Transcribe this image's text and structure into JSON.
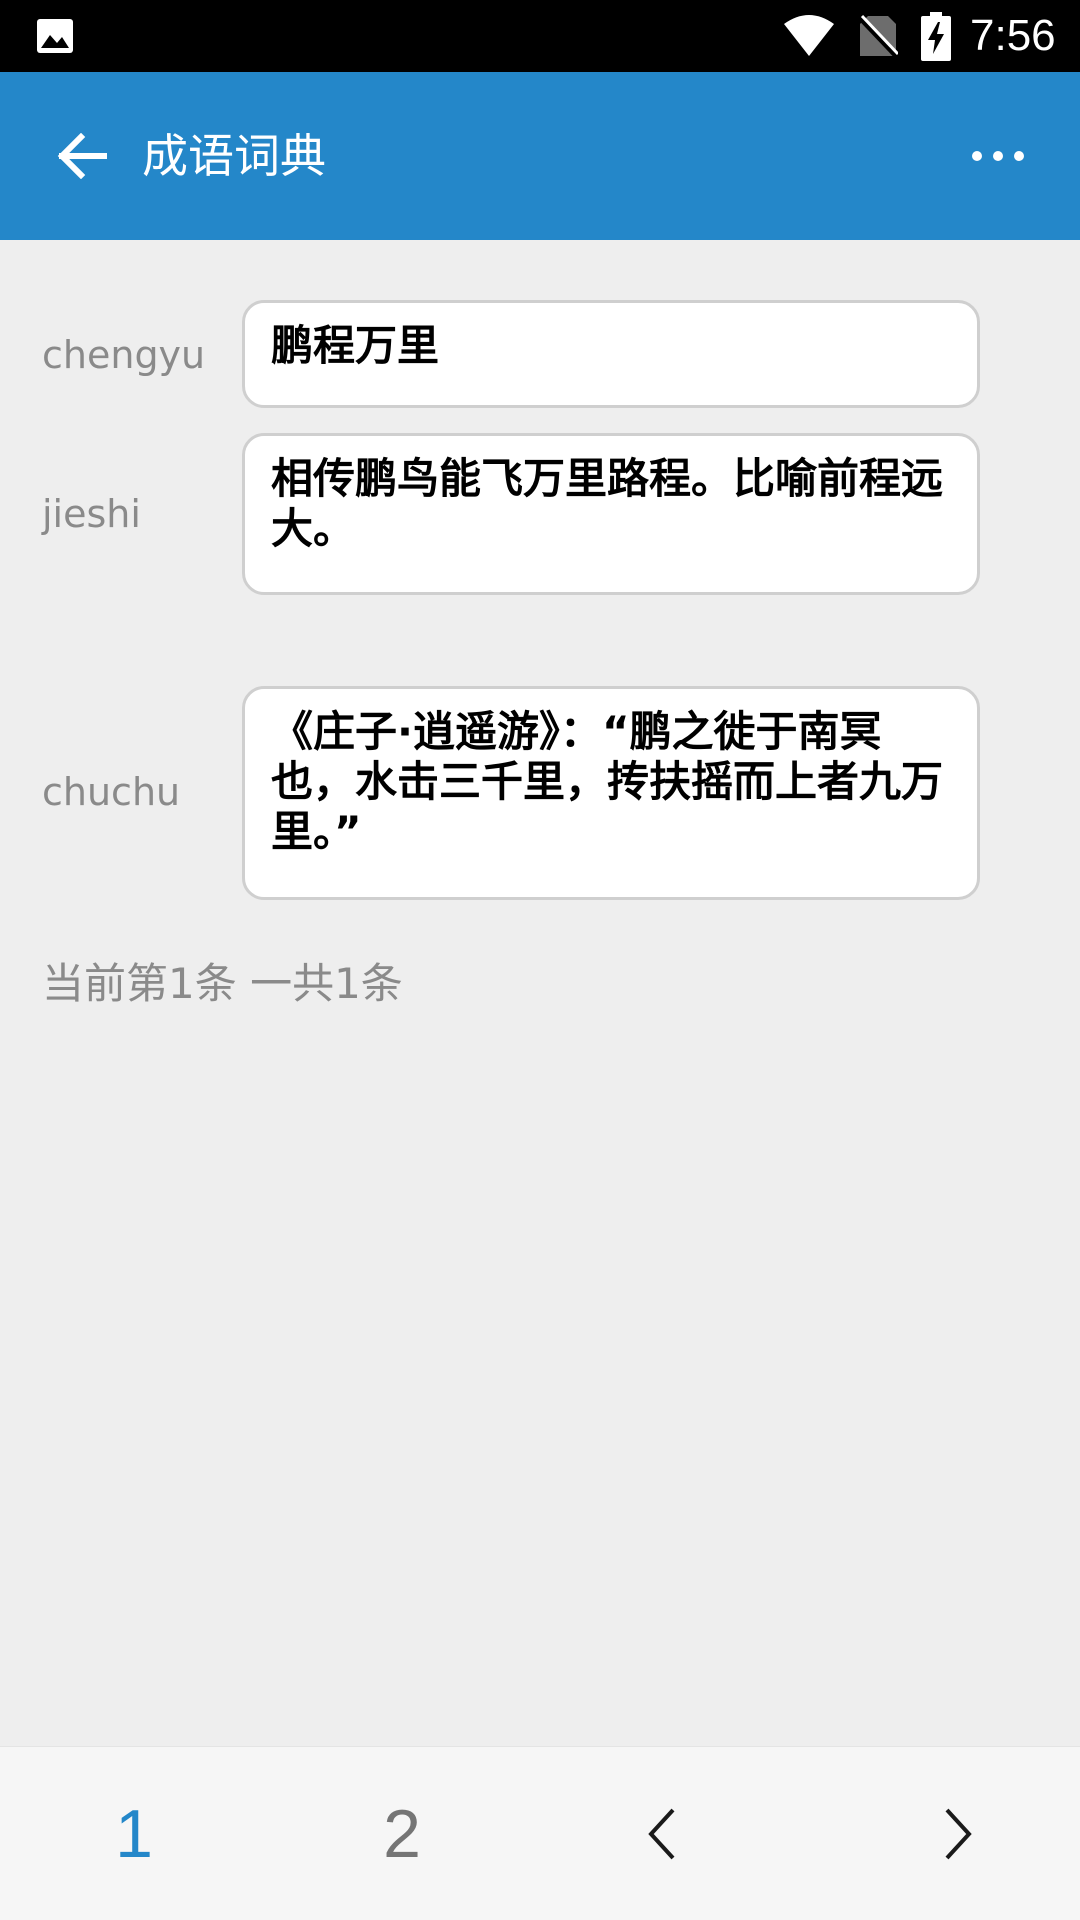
{
  "status_bar": {
    "time": "7:56",
    "icons": [
      "gallery-icon",
      "wifi-icon",
      "no-sim-icon",
      "battery-charging-icon"
    ]
  },
  "app_bar": {
    "title": "成语词典",
    "back_icon": "arrow-left-icon",
    "menu_icon": "more-horizontal-icon",
    "background_color": "#2487c9"
  },
  "fields": {
    "chengyu": {
      "label": "chengyu",
      "value": "鹏程万里"
    },
    "jieshi": {
      "label": "jieshi",
      "value": "相传鹏鸟能飞万里路程。比喻前程远大。"
    },
    "chuchu": {
      "label": "chuchu",
      "value": "《庄子·逍遥游》：“鹏之徙于南冥也，水击三千里，抟扶摇而上者九万里。”"
    }
  },
  "counter": "当前第1条 一共1条",
  "bottom_nav": {
    "page1": "1",
    "page2": "2",
    "prev_icon": "chevron-left-icon",
    "next_icon": "chevron-right-icon",
    "active_color": "#2487c9"
  }
}
